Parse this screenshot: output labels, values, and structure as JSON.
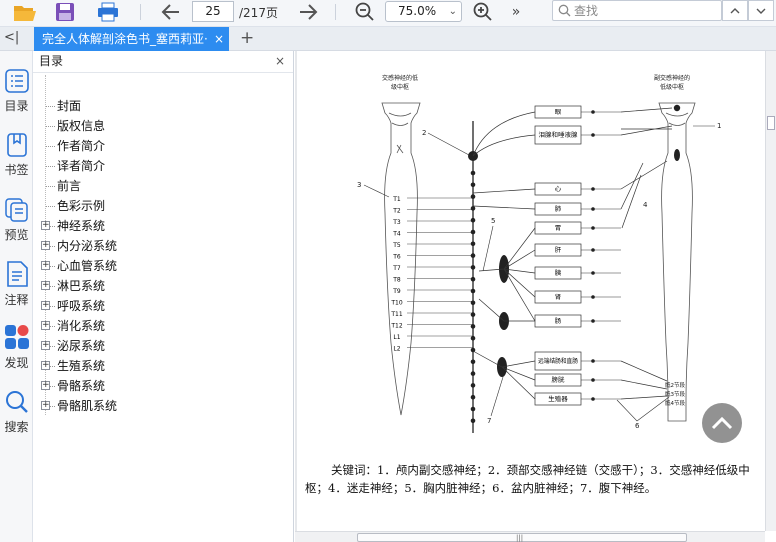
{
  "toolbar": {
    "page_current": "25",
    "page_total": "/217页",
    "zoom": "75.0%",
    "search_placeholder": "查找",
    "more": "»"
  },
  "tabbar": {
    "toggle": "<|",
    "tab_title": "完全人体解剖涂色书_塞西莉亚·",
    "tab_close": "×",
    "add": "+"
  },
  "leftbar": [
    {
      "label": "目录"
    },
    {
      "label": "书签"
    },
    {
      "label": "预览"
    },
    {
      "label": "注释"
    },
    {
      "label": "发现"
    },
    {
      "label": "搜索"
    }
  ],
  "toc": {
    "title": "目录",
    "close": "×",
    "items": [
      {
        "label": "封面",
        "expandable": false
      },
      {
        "label": "版权信息",
        "expandable": false
      },
      {
        "label": "作者简介",
        "expandable": false
      },
      {
        "label": "译者简介",
        "expandable": false
      },
      {
        "label": "前言",
        "expandable": false
      },
      {
        "label": "色彩示例",
        "expandable": false
      },
      {
        "label": "神经系统",
        "expandable": true
      },
      {
        "label": "内分泌系统",
        "expandable": true
      },
      {
        "label": "心血管系统",
        "expandable": true
      },
      {
        "label": "淋巴系统",
        "expandable": true
      },
      {
        "label": "呼吸系统",
        "expandable": true
      },
      {
        "label": "消化系统",
        "expandable": true
      },
      {
        "label": "泌尿系统",
        "expandable": true
      },
      {
        "label": "生殖系统",
        "expandable": true
      },
      {
        "label": "骨骼系统",
        "expandable": true
      },
      {
        "label": "骨骼肌系统",
        "expandable": true
      }
    ]
  },
  "figure": {
    "left_title_1": "交感神经的低",
    "left_title_2": "级中枢",
    "right_title_1": "副交感神经的",
    "right_title_2": "低级中枢",
    "vertebrae": [
      "T1",
      "T2",
      "T3",
      "T4",
      "T5",
      "T6",
      "T7",
      "T8",
      "T9",
      "T10",
      "T11",
      "T12",
      "L1",
      "L2"
    ],
    "organs": [
      "眼",
      "泪腺和唾液腺",
      "心",
      "肺",
      "胃",
      "肝",
      "胰",
      "肾",
      "肠",
      "远端结肠和直肠",
      "膀胱",
      "生殖器"
    ],
    "number_labels": [
      "1",
      "2",
      "3",
      "4",
      "5",
      "6",
      "7"
    ],
    "sacral_labels": [
      "骶2节段",
      "骶3节段",
      "骶4节段"
    ],
    "caption_line1": "关键词：1．颅内副交感神经；2．颈部交感神经链（交感干）；3．交感神经低级中",
    "caption_line2": "枢；4．迷走神经；5．胸内脏神经；6．盆内脏神经；7．腹下神经。"
  },
  "colors": {
    "tab_active": "#2d8cf0",
    "toolbar_bg": "#f4f6f9",
    "icon_blue": "#2b74d6",
    "icon_orange": "#f5a623",
    "icon_red": "#e84a4a"
  }
}
